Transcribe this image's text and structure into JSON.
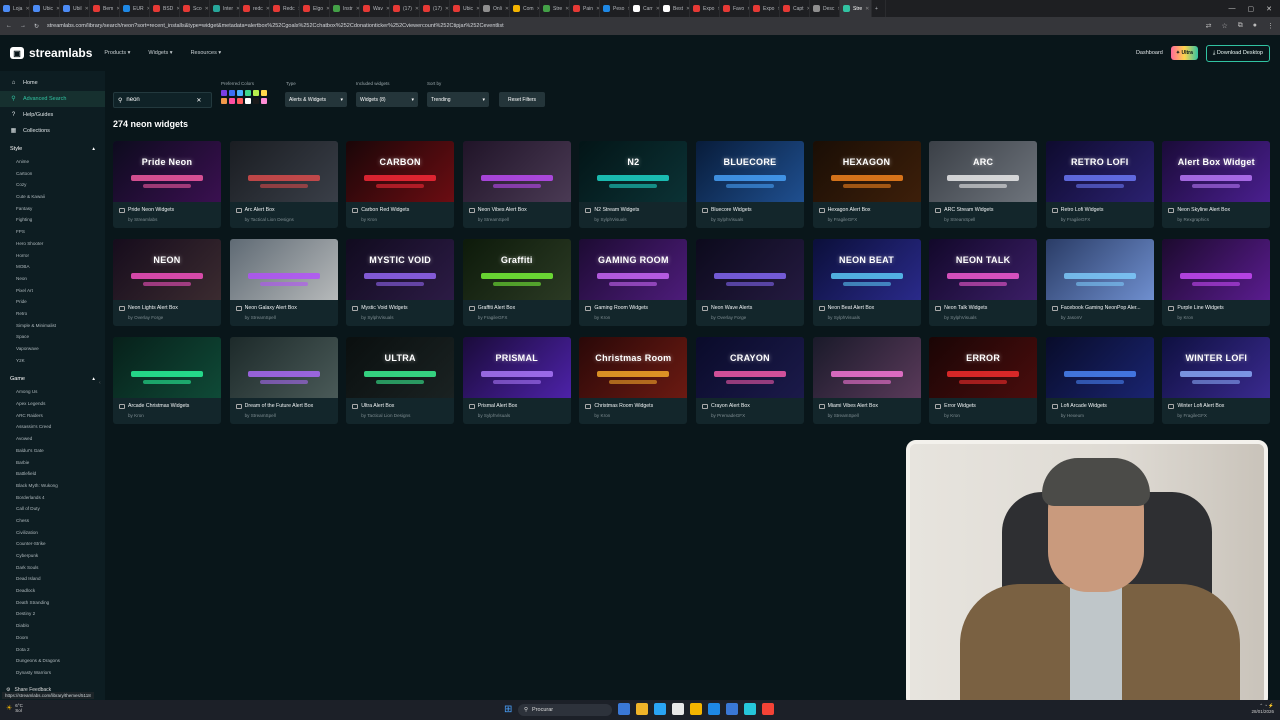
{
  "browser": {
    "tabs": [
      {
        "label": "Loja",
        "color": "#4c8bf5"
      },
      {
        "label": "Ubic",
        "color": "#4c8bf5"
      },
      {
        "label": "Ubil",
        "color": "#4c8bf5"
      },
      {
        "label": "Bem",
        "color": "#e53935"
      },
      {
        "label": "EUR",
        "color": "#1e88e5"
      },
      {
        "label": "BSD",
        "color": "#e53935"
      },
      {
        "label": "Sco",
        "color": "#e53935"
      },
      {
        "label": "Inter",
        "color": "#26a69a"
      },
      {
        "label": "redc",
        "color": "#e53935"
      },
      {
        "label": "Redc",
        "color": "#e53935"
      },
      {
        "label": "Elgo",
        "color": "#e53935"
      },
      {
        "label": "Instr",
        "color": "#43a047"
      },
      {
        "label": "Wav",
        "color": "#e53935"
      },
      {
        "label": "(17)",
        "color": "#e53935"
      },
      {
        "label": "(17)",
        "color": "#e53935"
      },
      {
        "label": "Ubic",
        "color": "#e53935"
      },
      {
        "label": "Onli",
        "color": "#8e8e8e"
      },
      {
        "label": "Com",
        "color": "#f4b400"
      },
      {
        "label": "Stre",
        "color": "#43a047"
      },
      {
        "label": "Pain",
        "color": "#e53935"
      },
      {
        "label": "Peso",
        "color": "#1e88e5"
      },
      {
        "label": "Carr",
        "color": "#ffffff"
      },
      {
        "label": "Best",
        "color": "#ffffff"
      },
      {
        "label": "Expo",
        "color": "#e53935"
      },
      {
        "label": "Favo",
        "color": "#e53935"
      },
      {
        "label": "Expo",
        "color": "#e53935"
      },
      {
        "label": "Capt",
        "color": "#e53935"
      },
      {
        "label": "Desc",
        "color": "#8e8e8e"
      },
      {
        "label": "Stre",
        "color": "#31c3a2",
        "active": true
      }
    ],
    "url": "streamlabs.com/library/search/neon?sort=recent_installs&type=widget&metadata=alertbox%252Cgoals%252Cchatbox%252Cdonationticker%252Cviewercount%252Ctipjar%252Ceventlist",
    "status_url": "https://streamlabs.com/library/themes/5118"
  },
  "header": {
    "brand": "streamlabs",
    "nav": [
      "Products",
      "Widgets",
      "Resources"
    ],
    "dashboard": "Dashboard",
    "ultra": "Ultra",
    "download": "Download Desktop"
  },
  "sidebar": {
    "items": [
      {
        "label": "Home",
        "icon": "home-icon",
        "glyph": "⌂"
      },
      {
        "label": "Advanced Search",
        "icon": "search-icon",
        "glyph": "⚲"
      },
      {
        "label": "Help/Guides",
        "icon": "help-icon",
        "glyph": "?"
      },
      {
        "label": "Collections",
        "icon": "collections-icon",
        "glyph": "▦"
      }
    ],
    "style_header": "Style",
    "styles": [
      "Anime",
      "Cartoon",
      "Cozy",
      "Cute & Kawaii",
      "Fantasy",
      "Fighting",
      "FPS",
      "Hero Shooter",
      "Horror",
      "MOBA",
      "Neon",
      "Pixel Art",
      "Pride",
      "Retro",
      "Simple & Minimalist",
      "Space",
      "Vaporwave",
      "Y2K"
    ],
    "game_header": "Game",
    "games": [
      "Among Us",
      "Apex Legends",
      "ARC Raiders",
      "Assassin's Creed",
      "Avowed",
      "Baldur's Gate",
      "Barbie",
      "Battlefield",
      "Black Myth: Wukong",
      "Borderlands 4",
      "Call of Duty",
      "Chess",
      "Civilization",
      "Counter-Strike",
      "Cyberpunk",
      "Dark Souls",
      "Dead Island",
      "Deadlock",
      "Death Stranding",
      "Destiny 2",
      "Diablo",
      "Doom",
      "Dota 2",
      "Dungeons & Dragons",
      "Dynasty Warriors"
    ],
    "feedback": "Share Feedback"
  },
  "filters": {
    "search_value": "neon",
    "colors_label": "Preferred Colors",
    "colors": [
      "#7b3fe4",
      "#3b6ef5",
      "#4ab0ff",
      "#3dd68c",
      "#b7f04d",
      "#ffd84a",
      "#f2994a",
      "#ff4fa3",
      "#ff5b5b",
      "#ffffff",
      "#1a1a1a",
      "#ff8ed6"
    ],
    "type_label": "Type",
    "type_value": "Alerts & Widgets",
    "included_label": "Included widgets",
    "included_value": "Widgets (8)",
    "sort_label": "Sort by",
    "sort_value": "Trending",
    "reset": "Reset Filters"
  },
  "results": {
    "count_text": "274 neon widgets",
    "cards": [
      {
        "title": "Pride Neon Widgets",
        "author": "by Streamlabs",
        "thumb": "Pride Neon",
        "c1": "#0d0b1e",
        "c2": "#3a1050",
        "accent": "#ff5fa8"
      },
      {
        "title": "Arc Alert Box",
        "author": "by Tactical Lion Designs",
        "thumb": "",
        "c1": "#1a1d22",
        "c2": "#3a3f48",
        "accent": "#e44d4d"
      },
      {
        "title": "Carbon Red Widgets",
        "author": "by Kron",
        "thumb": "CARBON",
        "c1": "#1a0608",
        "c2": "#6b0d12",
        "accent": "#ff2b3a"
      },
      {
        "title": "Neon Vibes Alert Box",
        "author": "by StreamSpell",
        "thumb": "",
        "c1": "#201428",
        "c2": "#4a3a54",
        "accent": "#c44dff"
      },
      {
        "title": "N2 Stream Widgets",
        "author": "by SylphVisuals",
        "thumb": "N2",
        "c1": "#031517",
        "c2": "#0b3235",
        "accent": "#1fe0d2"
      },
      {
        "title": "Bluecore Widgets",
        "author": "by SylphVisuals",
        "thumb": "BLUECORE",
        "c1": "#081c3a",
        "c2": "#1f4f8f",
        "accent": "#4aa6ff"
      },
      {
        "title": "Hexagon Alert Box",
        "author": "by FragileGFX",
        "thumb": "HEXAGON",
        "c1": "#1a0e05",
        "c2": "#3d1f0a",
        "accent": "#ff8a1f"
      },
      {
        "title": "ARC Stream Widgets",
        "author": "by StreamSpell",
        "thumb": "ARC",
        "c1": "#3b4047",
        "c2": "#6e747c",
        "accent": "#f2f2f2"
      },
      {
        "title": "Retro Lofi Widgets",
        "author": "by FragileGFX",
        "thumb": "RETRO LOFI",
        "c1": "#0e0b2e",
        "c2": "#2b2170",
        "accent": "#6f7dff"
      },
      {
        "title": "Neon Skyline Alert Box",
        "author": "by Rexgraphics",
        "thumb": "Alert Box Widget",
        "c1": "#1a0b38",
        "c2": "#4a1f8f",
        "accent": "#c07dff"
      },
      {
        "title": "Neon Lights Alert Box",
        "author": "by Overlay Forge",
        "thumb": "NEON",
        "c1": "#160c1c",
        "c2": "#3b2b30",
        "accent": "#ff54c8"
      },
      {
        "title": "Neon Galaxy Alert Box",
        "author": "by StreamSpell",
        "thumb": "",
        "c1": "#5f6a74",
        "c2": "#b6b9ba",
        "accent": "#b44dff"
      },
      {
        "title": "Mystic Void Widgets",
        "author": "by SylphVisuals",
        "thumb": "MYSTIC VOID",
        "c1": "#110b1f",
        "c2": "#2c1b45",
        "accent": "#9b6bff"
      },
      {
        "title": "Graffiti Alert Box",
        "author": "by FragileGFX",
        "thumb": "Graffiti",
        "c1": "#0d1a0a",
        "c2": "#2b3a24",
        "accent": "#7cff3a"
      },
      {
        "title": "Gaming Room Widgets",
        "author": "by Kron",
        "thumb": "GAMING ROOM",
        "c1": "#1d0b33",
        "c2": "#4d1c7a",
        "accent": "#d16bff"
      },
      {
        "title": "Neon Wave Alerts",
        "author": "by Overlay Forge",
        "thumb": "",
        "c1": "#0c0a1c",
        "c2": "#241a40",
        "accent": "#8a6bff"
      },
      {
        "title": "Neon Beat Alert Box",
        "author": "by SylphVisuals",
        "thumb": "NEON BEAT",
        "c1": "#0b0f3a",
        "c2": "#2a2a8a",
        "accent": "#5fd3ff"
      },
      {
        "title": "Neon Talk Widgets",
        "author": "by SylphVisuals",
        "thumb": "NEON TALK",
        "c1": "#12082a",
        "c2": "#3b1e66",
        "accent": "#ff5fd9"
      },
      {
        "title": "Facebook Gaming NeonPop Aler...",
        "author": "by JasonV",
        "thumb": "",
        "c1": "#2a3c66",
        "c2": "#6f8fcf",
        "accent": "#7fd0ff"
      },
      {
        "title": "Purple Line Widgets",
        "author": "by Kron",
        "thumb": "",
        "c1": "#1c0a2e",
        "c2": "#5a1c8f",
        "accent": "#d04dff"
      },
      {
        "title": "Arcade Christmas Widgets",
        "author": "by Kron",
        "thumb": "",
        "c1": "#07201a",
        "c2": "#0f4a37",
        "accent": "#2bffa0"
      },
      {
        "title": "Dream of the Future Alert Box",
        "author": "by StreamSpell",
        "thumb": "",
        "c1": "#1d2a2a",
        "c2": "#4a5a58",
        "accent": "#b06bff"
      },
      {
        "title": "Ultra Alert Box",
        "author": "by Tactical Lion Designs",
        "thumb": "ULTRA",
        "c1": "#0a0f0f",
        "c2": "#1a2222",
        "accent": "#3dff9a"
      },
      {
        "title": "Prismal Alert Box",
        "author": "by SylphVisuals",
        "thumb": "PRISMAL",
        "c1": "#1a0b3a",
        "c2": "#4d22a8",
        "accent": "#b07dff"
      },
      {
        "title": "Christmas Room Widgets",
        "author": "by Kron",
        "thumb": "Christmas Room",
        "c1": "#2a0808",
        "c2": "#6b1a12",
        "accent": "#ffb02b"
      },
      {
        "title": "Crayon Alert Box",
        "author": "by PremadeGFX",
        "thumb": "CRAYON",
        "c1": "#0a0b2a",
        "c2": "#1b1a4a",
        "accent": "#ff5fb0"
      },
      {
        "title": "Miami Vibes Alert Box",
        "author": "by StreamSpell",
        "thumb": "",
        "c1": "#1a1a2a",
        "c2": "#5a3a5a",
        "accent": "#ff7adf"
      },
      {
        "title": "Error Widgets",
        "author": "by Kron",
        "thumb": "ERROR",
        "c1": "#1a0505",
        "c2": "#4a0d0d",
        "accent": "#ff3030"
      },
      {
        "title": "Lofi Arcade Widgets",
        "author": "by Hexeum",
        "thumb": "",
        "c1": "#080c2a",
        "c2": "#1a2470",
        "accent": "#4d8bff"
      },
      {
        "title": "Winter Lofi Alert Box",
        "author": "by FragileGFX",
        "thumb": "WINTER LOFI",
        "c1": "#0e1040",
        "c2": "#3a2a8f",
        "accent": "#8fb0ff"
      }
    ]
  },
  "taskbar": {
    "weather": "6°C",
    "weather_sub": "Sol",
    "search_placeholder": "Procurar",
    "apps": [
      "#3a78d6",
      "#f0b429",
      "#2aa4f4",
      "#e8e8e8",
      "#f4b400",
      "#1e88e5",
      "#3a78d6",
      "#26c6da",
      "#f44336"
    ],
    "date": "28/01/2026"
  }
}
